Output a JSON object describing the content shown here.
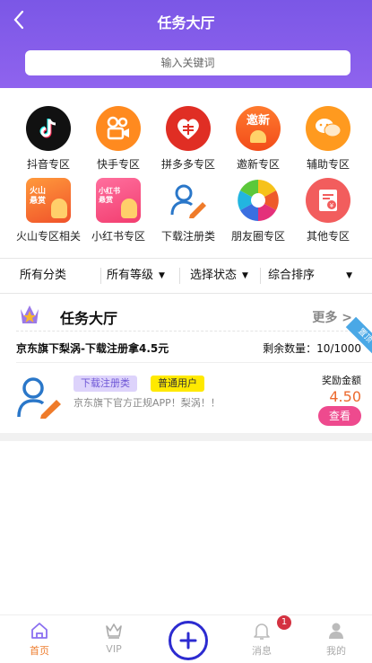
{
  "header": {
    "title": "任务大厅",
    "search_placeholder": "输入关键词"
  },
  "categories": [
    {
      "label": "抖音专区",
      "icon": "tiktok-icon"
    },
    {
      "label": "快手专区",
      "icon": "kuaishou-icon"
    },
    {
      "label": "拼多多专区",
      "icon": "pinduoduo-icon"
    },
    {
      "label": "邀新专区",
      "icon": "invite-icon",
      "icon_text": "邀新"
    },
    {
      "label": "辅助专区",
      "icon": "wechat-icon"
    },
    {
      "label": "火山专区相关",
      "icon": "huoshan-icon",
      "icon_text": "火山\n悬赏"
    },
    {
      "label": "小红书专区",
      "icon": "xiaohongshu-icon",
      "icon_text": "小红书\n悬赏"
    },
    {
      "label": "下载注册类",
      "icon": "user-pen-icon"
    },
    {
      "label": "朋友圈专区",
      "icon": "aperture-icon"
    },
    {
      "label": "其他专区",
      "icon": "document-icon"
    }
  ],
  "filters": {
    "all_categories": "所有分类",
    "all_levels": "所有等级",
    "select_status": "选择状态",
    "sort": "综合排序"
  },
  "hall": {
    "title": "任务大厅",
    "more": "更多 >"
  },
  "task": {
    "name": "京东旗下梨涡-下载注册拿4.5元",
    "remaining": "剩余数量：10/1000",
    "ribbon": "置顶",
    "tag_type": "下载注册类",
    "tag_user": "普通用户",
    "description": "京东旗下官方正规APP！梨涡！！",
    "reward_label": "奖励金额",
    "reward_value": "4.50",
    "view_button": "查看"
  },
  "nav": {
    "home": "首页",
    "vip": "VIP",
    "messages": "消息",
    "mine": "我的",
    "message_badge": "1"
  },
  "colors": {
    "header_purple": "#7b57e6",
    "accent_orange": "#ee7d2e",
    "view_pink": "#ee4a8e",
    "tag_yellow": "#ffe900",
    "plus_blue": "#2c2bd0"
  }
}
